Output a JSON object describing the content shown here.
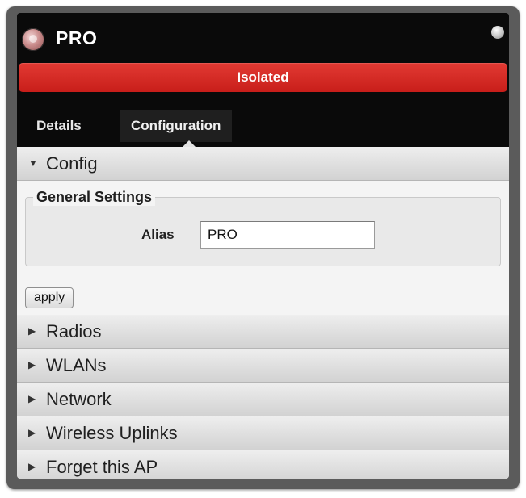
{
  "window": {
    "title": "PRO",
    "status": "Isolated",
    "status_color": "#d62a25"
  },
  "tabs": [
    {
      "label": "Details",
      "active": false
    },
    {
      "label": "Configuration",
      "active": true
    }
  ],
  "config": {
    "header": "Config",
    "expanded": true,
    "group_title": "General Settings",
    "alias_label": "Alias",
    "alias_value": "PRO",
    "apply_label": "apply"
  },
  "sections": [
    {
      "label": "Radios",
      "expanded": false
    },
    {
      "label": "WLANs",
      "expanded": false
    },
    {
      "label": "Network",
      "expanded": false
    },
    {
      "label": "Wireless Uplinks",
      "expanded": false
    },
    {
      "label": "Forget this AP",
      "expanded": false
    }
  ],
  "icons": {
    "expanded": "triangle-down-icon",
    "collapsed": "triangle-right-icon",
    "ap": "access-point-icon",
    "close": "close-icon"
  }
}
